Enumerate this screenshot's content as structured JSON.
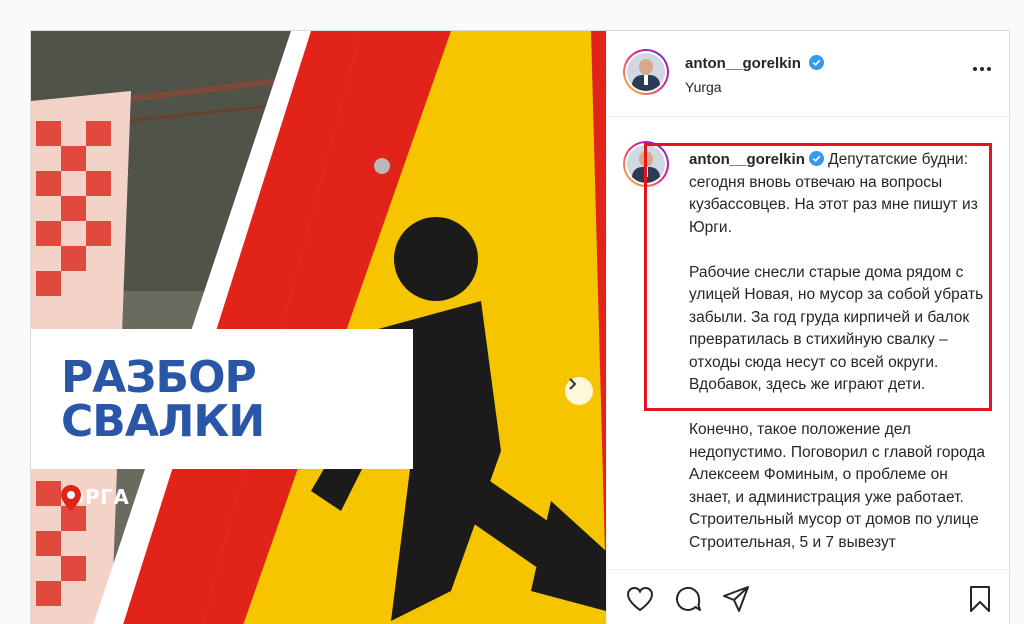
{
  "media": {
    "banner_lines": [
      "РАЗБОР",
      "СВАЛКИ"
    ],
    "location_tag": "ЮРГА",
    "next_icon": "chevron-right-icon"
  },
  "header": {
    "username": "anton__gorelkin",
    "location": "Yurga",
    "more_icon": "more-horizontal-icon"
  },
  "caption": {
    "username": "anton__gorelkin",
    "paragraphs": [
      "Депутатские будни: сегодня вновь отвечаю на вопросы кузбассовцев. На этот раз мне пишут из Юрги.",
      "Рабочие снесли старые дома рядом с улицей Новая, но мусор за собой убрать забыли. За год груда кирпичей и балок превратилась в стихийную свалку – отходы сюда несут со всей округи. Вдобавок, здесь же играют дети.",
      "Конечно, такое положение дел недопустимо. Поговорил с главой города Алексеем Фоминым, о проблеме он знает, и администрация уже работает. Строительный мусор от домов по улице Строительная, 5 и 7 вывезут"
    ]
  },
  "actions": [
    "heart-icon",
    "comment-icon",
    "share-icon",
    "bookmark-icon"
  ],
  "colors": {
    "highlight": "#e6121f",
    "banner_text": "#2a56a8",
    "sign_yellow": "#f5c500",
    "sign_red": "#e2231a"
  }
}
